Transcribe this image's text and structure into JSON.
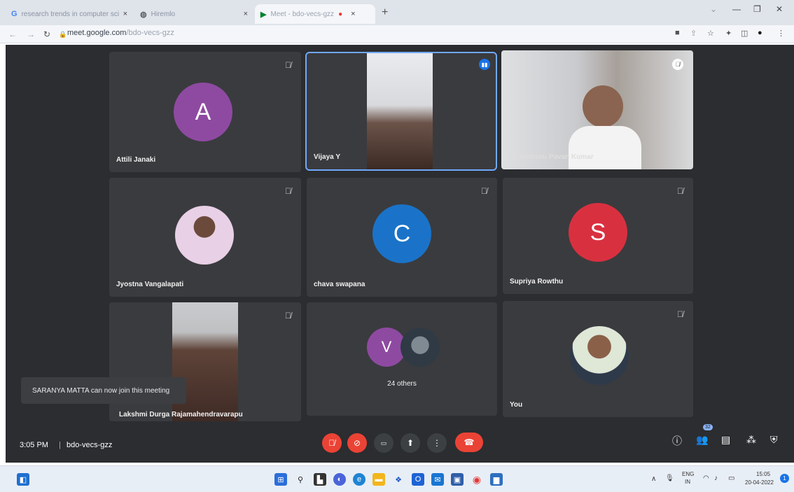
{
  "browser": {
    "tabs": [
      {
        "title": "research trends in computer scie",
        "favicon": "google-icon",
        "close": "×"
      },
      {
        "title": "Hiremlo",
        "favicon": "globe-icon",
        "close": "×"
      },
      {
        "title": "Meet - bdo-vecs-gzz",
        "favicon": "meet-icon",
        "close": "×",
        "active": true
      }
    ],
    "new_tab": "+",
    "url_host": "meet.google.com",
    "url_path": "/bdo-vecs-gzz"
  },
  "tiles": [
    {
      "name": "Attili Janaki",
      "avatar_letter": "A",
      "avatar_color": "#8e4aa1"
    },
    {
      "name": "Vijaya Y",
      "speaking": true
    },
    {
      "name": "Dr. Vadrevu Pavan Kumar"
    },
    {
      "name": "Jyostna Vangalapati"
    },
    {
      "name": "chava swapana",
      "avatar_letter": "C",
      "avatar_color": "#1a73c8"
    },
    {
      "name": "Supriya Rowthu",
      "avatar_letter": "S",
      "avatar_color": "#d93040"
    },
    {
      "name": "Lakshmi Durga Rajamahendravarapu"
    },
    {
      "name": "24 others",
      "avatar_letter": "V",
      "avatar_color": "#8e4aa1"
    },
    {
      "name": "You"
    }
  ],
  "toast": "SARANYA MATTA can now join this meeting",
  "meeting": {
    "time": "3:05 PM",
    "separator": "|",
    "code": "bdo-vecs-gzz",
    "participant_count": "32"
  },
  "colors": {
    "leave": "#ea4335",
    "speaking_outline": "#6fa8ff"
  },
  "taskbar": {
    "lang_top": "ENG",
    "lang_bottom": "IN",
    "clock_time": "15:05",
    "clock_date": "20-04-2022"
  }
}
